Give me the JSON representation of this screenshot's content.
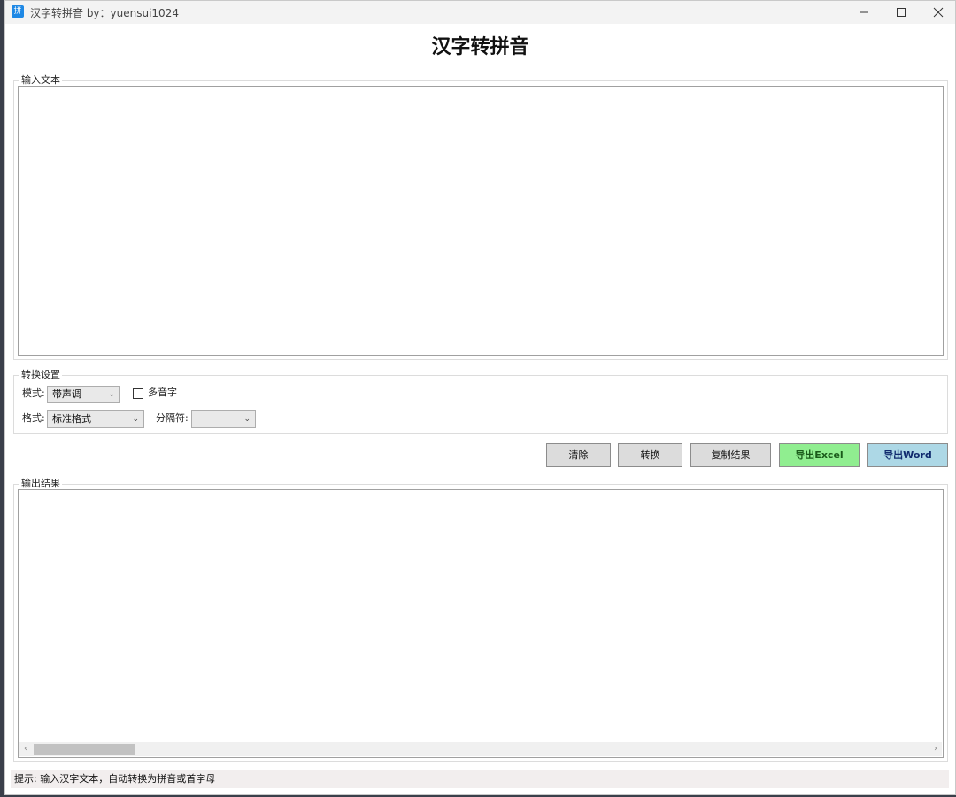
{
  "window": {
    "title": "汉字转拼音 by：yuensui1024",
    "icon_glyph": "拼",
    "icon_color": "#1e88e5"
  },
  "app_title": "汉字转拼音",
  "input_group": {
    "label": "输入文本",
    "value": ""
  },
  "settings": {
    "label": "转换设置",
    "mode_label": "模式:",
    "mode_value": "带声调",
    "polyphone_label": "多音字",
    "polyphone_checked": false,
    "format_label": "格式:",
    "format_value": "标准格式",
    "separator_label": "分隔符:",
    "separator_value": ""
  },
  "buttons": {
    "clear": "清除",
    "convert": "转换",
    "copy": "复制结果",
    "export_excel": "导出Excel",
    "export_word": "导出Word",
    "excel_color": "#90ee90",
    "word_color": "#add8e6"
  },
  "output_group": {
    "label": "输出结果",
    "value": ""
  },
  "status": "提示: 输入汉字文本，自动转换为拼音或首字母"
}
